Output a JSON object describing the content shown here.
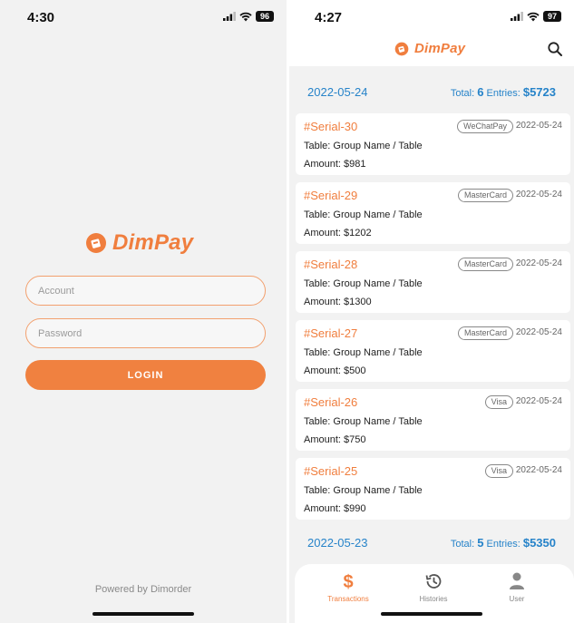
{
  "login_screen": {
    "status": {
      "time": "4:30",
      "battery": "96"
    },
    "brand": "DimPay",
    "account_placeholder": "Account",
    "password_placeholder": "Password",
    "login_label": "LOGIN",
    "powered_by": "Powered by Dimorder"
  },
  "transactions_screen": {
    "status": {
      "time": "4:27",
      "battery": "97"
    },
    "brand": "DimPay",
    "groups": [
      {
        "date": "2022-05-24",
        "total_label": "Total:",
        "count": "6",
        "entries_label": "Entries:",
        "amount": "$5723"
      },
      {
        "date": "2022-05-23",
        "total_label": "Total:",
        "count": "5",
        "entries_label": "Entries:",
        "amount": "$5350"
      }
    ],
    "cards": [
      {
        "serial": "#Serial-30",
        "method": "WeChatPay",
        "date": "2022-05-24",
        "table": "Table: Group Name / Table",
        "amount": "Amount: $981"
      },
      {
        "serial": "#Serial-29",
        "method": "MasterCard",
        "date": "2022-05-24",
        "table": "Table: Group Name / Table",
        "amount": "Amount: $1202"
      },
      {
        "serial": "#Serial-28",
        "method": "MasterCard",
        "date": "2022-05-24",
        "table": "Table: Group Name / Table",
        "amount": "Amount: $1300"
      },
      {
        "serial": "#Serial-27",
        "method": "MasterCard",
        "date": "2022-05-24",
        "table": "Table: Group Name / Table",
        "amount": "Amount: $500"
      },
      {
        "serial": "#Serial-26",
        "method": "Visa",
        "date": "2022-05-24",
        "table": "Table: Group Name / Table",
        "amount": "Amount: $750"
      },
      {
        "serial": "#Serial-25",
        "method": "Visa",
        "date": "2022-05-24",
        "table": "Table: Group Name / Table",
        "amount": "Amount: $990"
      }
    ],
    "tabs": [
      {
        "label": "Transactions",
        "icon": "dollar-icon",
        "active": true
      },
      {
        "label": "Histories",
        "icon": "history-icon",
        "active": false
      },
      {
        "label": "User",
        "icon": "user-icon",
        "active": false
      }
    ]
  },
  "colors": {
    "brand_orange": "#f07e3e",
    "link_blue": "#2683c9",
    "background": "#f2f2f2"
  }
}
